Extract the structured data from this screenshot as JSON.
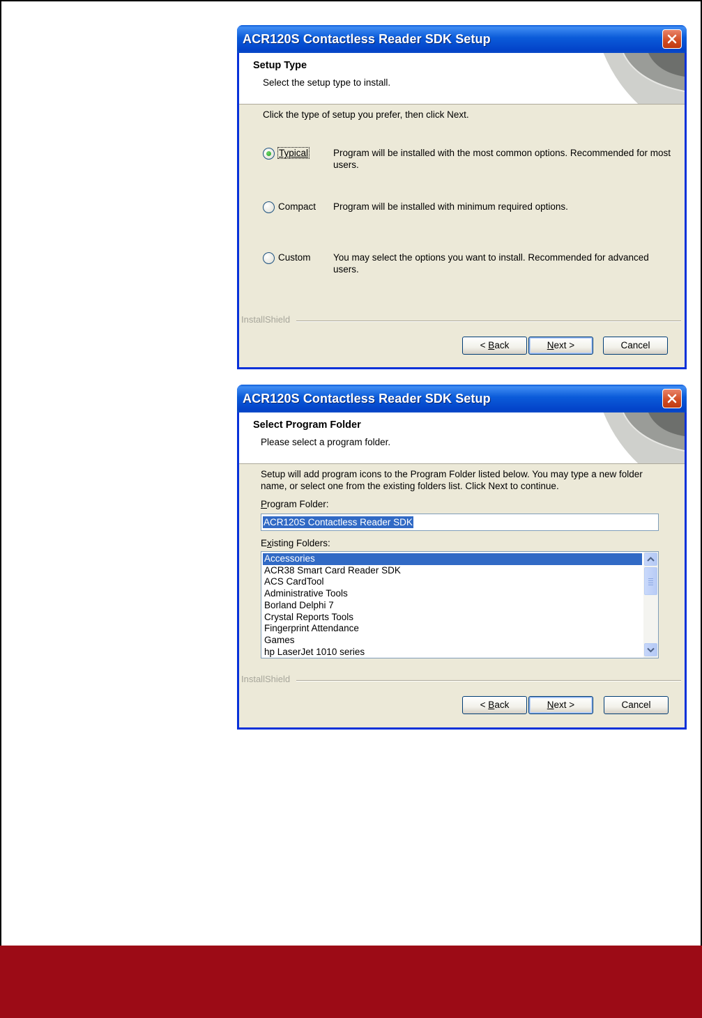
{
  "dialog1": {
    "title": "ACR120S Contactless Reader SDK Setup",
    "header_title": "Setup Type",
    "header_subtitle": "Select the setup type to install.",
    "intro": "Click the type of setup you prefer, then click Next.",
    "options": [
      {
        "label": "Typical",
        "description": "Program will be installed with the most common options.  Recommended for most users.",
        "selected": true
      },
      {
        "label": "Compact",
        "description": "Program will be installed with minimum required options.",
        "selected": false
      },
      {
        "label": "Custom",
        "description": "You may select the options you want to install. Recommended for advanced users.",
        "selected": false
      }
    ],
    "brand": "InstallShield",
    "buttons": {
      "back_arrow": "< ",
      "back_key": "B",
      "back_rest": "ack",
      "next_key": "N",
      "next_rest": "ext >",
      "cancel": "Cancel"
    }
  },
  "dialog2": {
    "title": "ACR120S Contactless Reader SDK Setup",
    "header_title": "Select Program Folder",
    "header_subtitle": "Please select a program folder.",
    "intro": "Setup will add program icons to the Program Folder listed below.  You may type a new folder name, or select one from the existing folders list.  Click Next to continue.",
    "program_folder_label_key": "P",
    "program_folder_label_rest": "rogram Folder:",
    "program_folder_value": "ACR120S Contactless Reader SDK",
    "existing_label_pre": "E",
    "existing_label_key": "x",
    "existing_label_rest": "isting Folders:",
    "folders": [
      "Accessories",
      "ACR38 Smart Card Reader SDK",
      "ACS CardTool",
      "Administrative Tools",
      "Borland Delphi 7",
      "Crystal Reports Tools",
      "Fingerprint Attendance",
      "Games",
      "hp LaserJet 1010 series"
    ],
    "selected_folder": "Accessories",
    "brand": "InstallShield",
    "buttons": {
      "back_arrow": "< ",
      "back_key": "B",
      "back_rest": "ack",
      "next_key": "N",
      "next_rest": "ext >",
      "cancel": "Cancel"
    }
  },
  "colors": {
    "title_bar": "#0b5bd9",
    "dialog_bg": "#ece9d8",
    "selection": "#316ac5",
    "footer_bar": "#9c0b16"
  }
}
